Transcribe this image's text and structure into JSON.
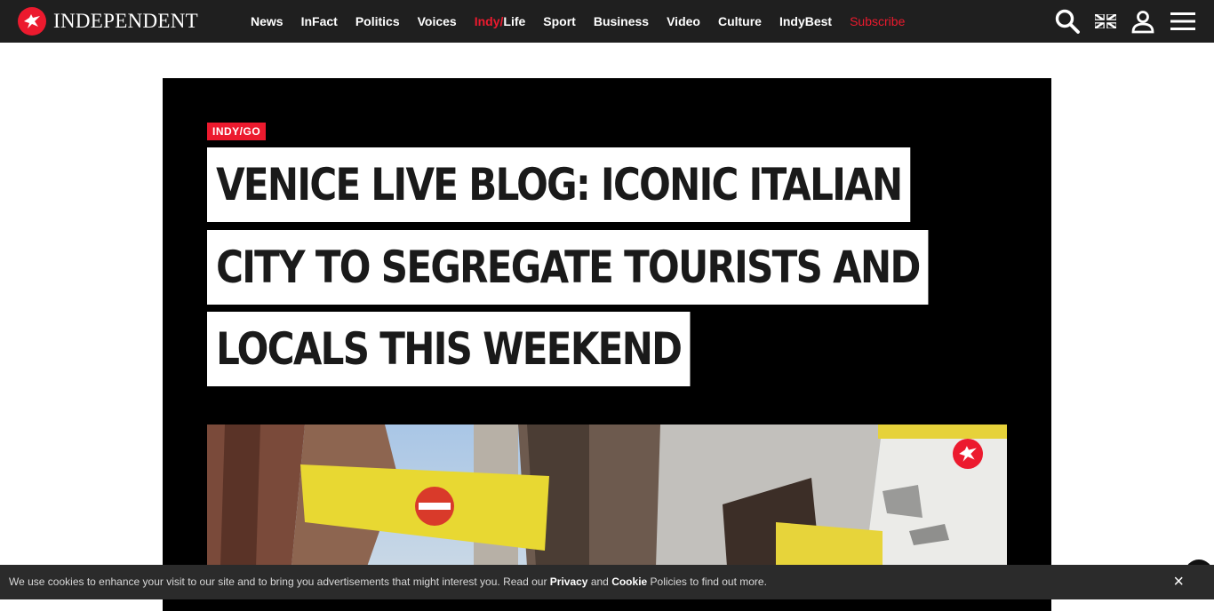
{
  "brand": {
    "name": "INDEPENDENT"
  },
  "nav": {
    "items": [
      "News",
      "InFact",
      "Politics",
      "Voices"
    ],
    "indy_life": {
      "part1": "Indy/",
      "part2": "Life"
    },
    "items2": [
      "Sport",
      "Business",
      "Video",
      "Culture",
      "IndyBest"
    ],
    "subscribe": "Subscribe"
  },
  "icons": [
    "search-icon",
    "uk-flag-icon",
    "user-icon",
    "menu-icon"
  ],
  "article": {
    "tag": "INDY/GO",
    "headline_lines": [
      "VENICE LIVE BLOG: ICONIC ITALIAN",
      "CITY TO SEGREGATE TOURISTS AND",
      "LOCALS THIS WEEKEND"
    ]
  },
  "cookie": {
    "text_before": "We use cookies to enhance your visit to our site and to bring you advertisements that might interest you. Read our ",
    "privacy": "Privacy",
    "and": " and ",
    "cookie": "Cookie",
    "text_after": " Policies to find out more.",
    "close": "×"
  },
  "colors": {
    "brand_red": "#ec1a2e",
    "topbar": "#1f1f1f",
    "hero_bg": "#000000"
  }
}
